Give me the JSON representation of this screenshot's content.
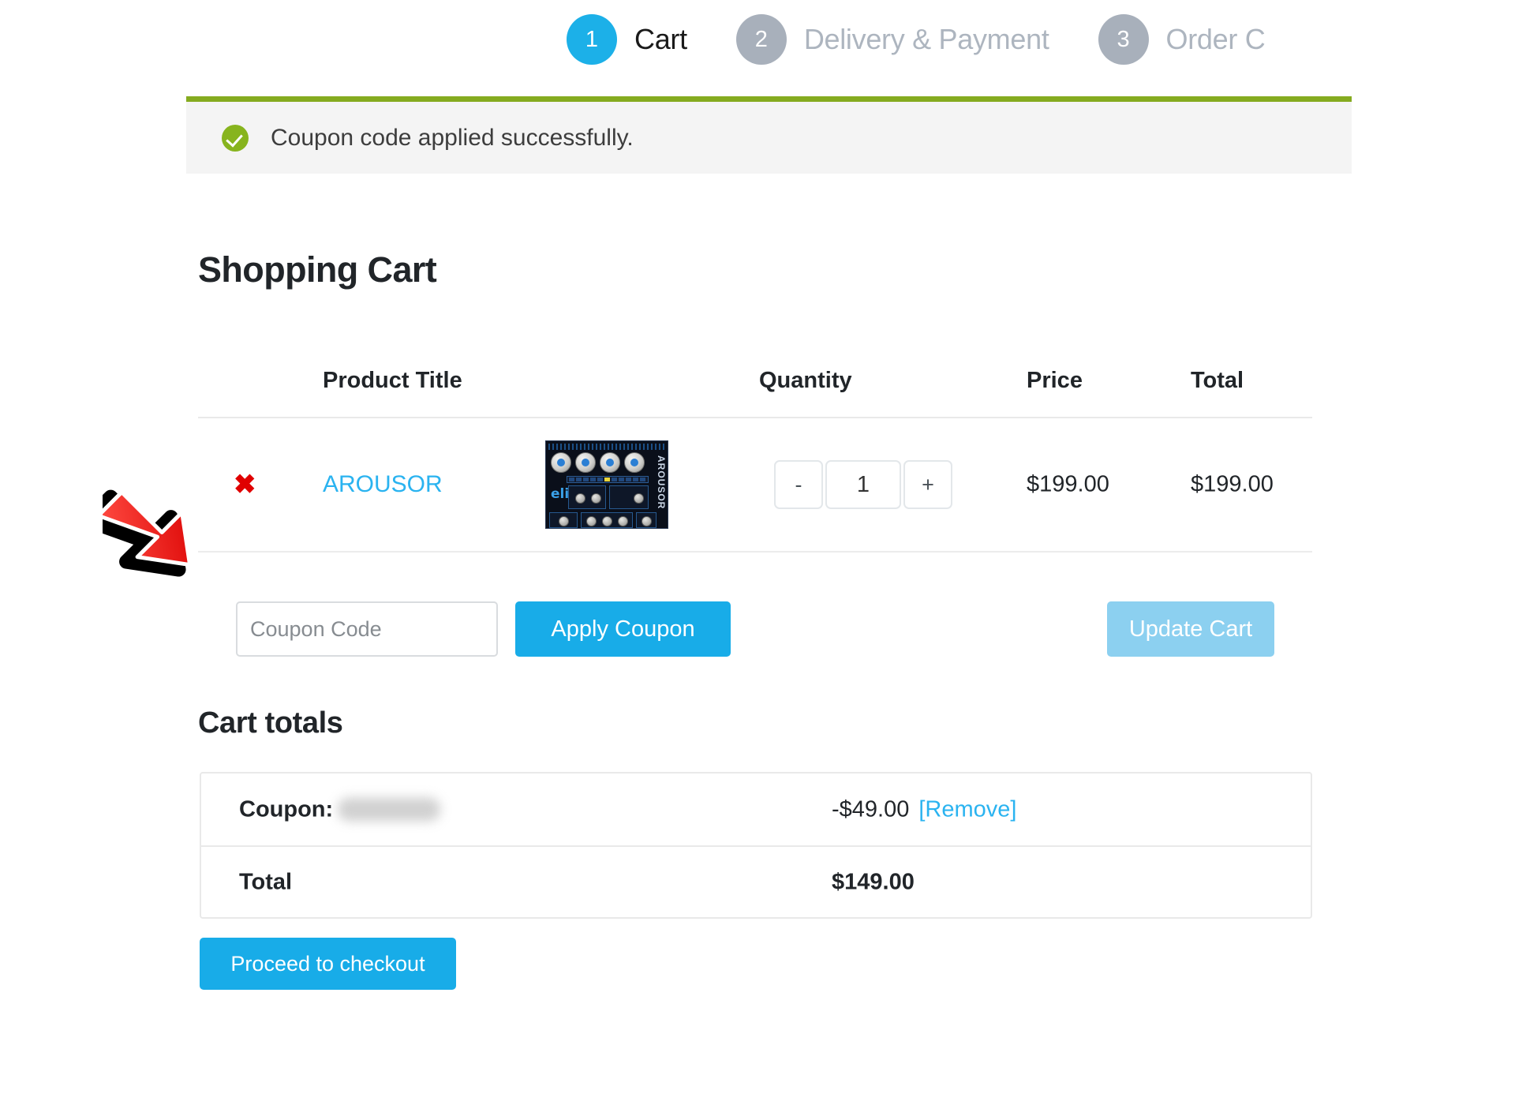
{
  "steps": [
    {
      "number": "1",
      "label": "Cart",
      "state": "active"
    },
    {
      "number": "2",
      "label": "Delivery & Payment",
      "state": "inactive"
    },
    {
      "number": "3",
      "label": "Order C",
      "state": "inactive"
    }
  ],
  "notice": {
    "icon": "check-circle-icon",
    "message": "Coupon code applied successfully.",
    "accent_color": "#85ab1f"
  },
  "headings": {
    "shopping_cart": "Shopping Cart",
    "cart_totals": "Cart totals"
  },
  "cart_table": {
    "columns": {
      "product": "Product Title",
      "quantity": "Quantity",
      "price": "Price",
      "total": "Total"
    },
    "rows": [
      {
        "remove_symbol": "✖",
        "name": "AROUSOR",
        "thumb_label": "AROUSOR",
        "qty_minus": "-",
        "qty_value": "1",
        "qty_plus": "+",
        "price": "$199.00",
        "total": "$199.00"
      }
    ]
  },
  "coupon": {
    "placeholder": "Coupon Code",
    "value": "",
    "apply_label": "Apply Coupon",
    "update_label": "Update Cart"
  },
  "totals": {
    "coupon_label": "Coupon:",
    "coupon_code_redacted": true,
    "coupon_amount": "-$49.00",
    "remove_label": "[Remove]",
    "total_label": "Total",
    "total_amount": "$149.00"
  },
  "checkout": {
    "label": "Proceed to checkout"
  },
  "colors": {
    "primary_blue": "#18ace8",
    "light_blue": "#8cd0f0",
    "link_blue": "#2ab3f0",
    "step_inactive": "#a8b0bb",
    "success_green": "#85ab1f",
    "remove_red": "#e00000",
    "annotation_red": "#ee2222"
  },
  "annotation": {
    "type": "arrow",
    "direction": "down-right",
    "points_to": "coupon-code-input"
  }
}
